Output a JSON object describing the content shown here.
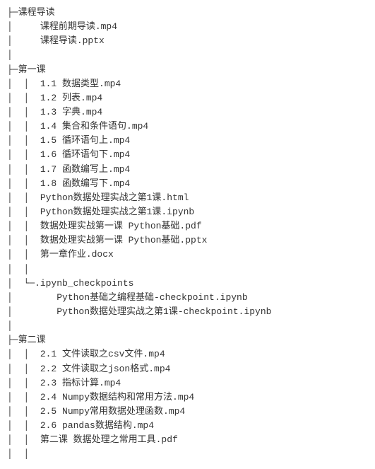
{
  "tree": {
    "prefixes": {
      "folder0": "├─",
      "pipe1": "│     ",
      "pipe2": "│  │  ",
      "elbow2": "│  └─",
      "pipe3deep": "│        "
    },
    "section1": {
      "title": "课程导读",
      "files": [
        "课程前期导读.mp4",
        "课程导读.pptx"
      ]
    },
    "section2": {
      "title": "第一课",
      "files": [
        "1.1 数据类型.mp4",
        "1.2 列表.mp4",
        "1.3 字典.mp4",
        "1.4 集合和条件语句.mp4",
        "1.5 循环语句上.mp4",
        "1.6 循环语句下.mp4",
        "1.7 函数编写上.mp4",
        "1.8 函数编写下.mp4",
        "Python数据处理实战之第1课.html",
        "Python数据处理实战之第1课.ipynb",
        "数据处理实战第一课 Python基础.pdf",
        "数据处理实战第一课 Python基础.pptx",
        "第一章作业.docx"
      ],
      "subfolder": {
        "name": ".ipynb_checkpoints",
        "files": [
          "Python基础之编程基础-checkpoint.ipynb",
          "Python数据处理实战之第1课-checkpoint.ipynb"
        ]
      }
    },
    "section3": {
      "title": "第二课",
      "files": [
        "2.1 文件读取之csv文件.mp4",
        "2.2 文件读取之json格式.mp4",
        "2.3 指标计算.mp4",
        "2.4 Numpy数据结构和常用方法.mp4",
        "2.5 Numpy常用数据处理函数.mp4",
        "2.6 pandas数据结构.mp4",
        "第二课 数据处理之常用工具.pdf"
      ]
    }
  }
}
